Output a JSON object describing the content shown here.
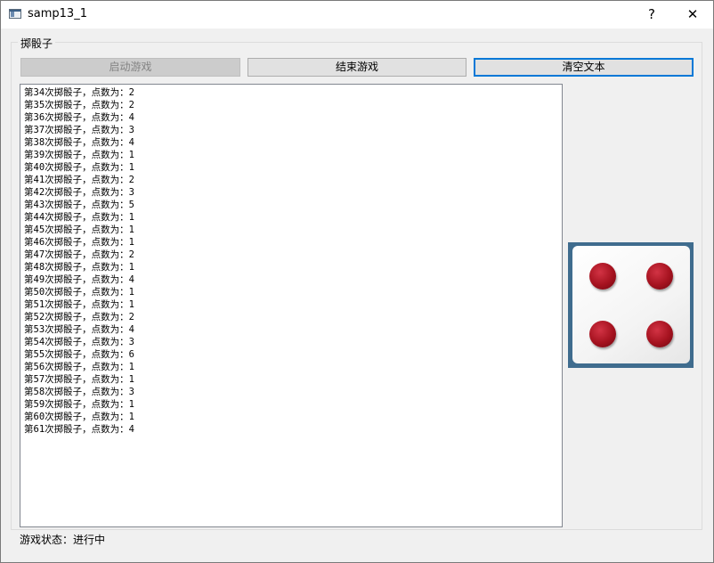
{
  "window": {
    "title": "samp13_1",
    "help_label": "?",
    "close_label": "✕"
  },
  "group": {
    "label": "掷骰子"
  },
  "buttons": {
    "start": "启动游戏",
    "end": "结束游戏",
    "clear": "清空文本"
  },
  "log": [
    "第34次掷骰子，点数为：2",
    "第35次掷骰子，点数为：2",
    "第36次掷骰子，点数为：4",
    "第37次掷骰子，点数为：3",
    "第38次掷骰子，点数为：4",
    "第39次掷骰子，点数为：1",
    "第40次掷骰子，点数为：1",
    "第41次掷骰子，点数为：2",
    "第42次掷骰子，点数为：3",
    "第43次掷骰子，点数为：5",
    "第44次掷骰子，点数为：1",
    "第45次掷骰子，点数为：1",
    "第46次掷骰子，点数为：1",
    "第47次掷骰子，点数为：2",
    "第48次掷骰子，点数为：1",
    "第49次掷骰子，点数为：4",
    "第50次掷骰子，点数为：1",
    "第51次掷骰子，点数为：1",
    "第52次掷骰子，点数为：2",
    "第53次掷骰子，点数为：4",
    "第54次掷骰子，点数为：3",
    "第55次掷骰子，点数为：6",
    "第56次掷骰子，点数为：1",
    "第57次掷骰子，点数为：1",
    "第58次掷骰子，点数为：3",
    "第59次掷骰子，点数为：1",
    "第60次掷骰子，点数为：1",
    "第61次掷骰子，点数为：4"
  ],
  "dice": {
    "value": 4
  },
  "status": "游戏状态：进行中",
  "colors": {
    "accent": "#0078d7",
    "dice_frame": "#3f6c8e",
    "pip": "#a5121f"
  },
  "icons": {
    "app": "window-app-icon",
    "help": "help-icon",
    "close": "close-icon"
  }
}
